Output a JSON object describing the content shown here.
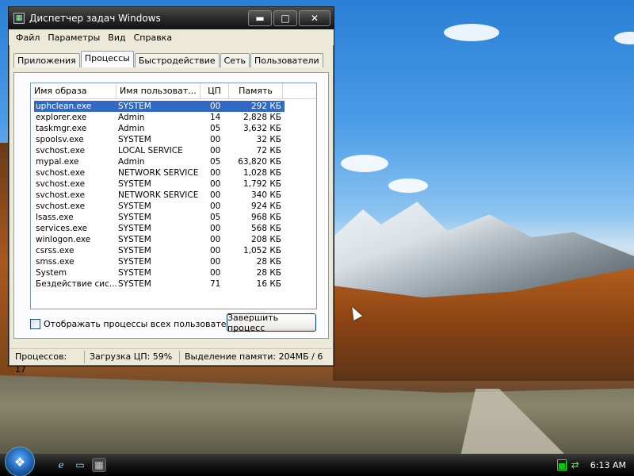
{
  "window": {
    "title": "Диспетчер задач Windows",
    "controls": {
      "minimize": "▬",
      "maximize": "□",
      "close": "✕"
    }
  },
  "menu": [
    "Файл",
    "Параметры",
    "Вид",
    "Справка"
  ],
  "tabs": [
    "Приложения",
    "Процессы",
    "Быстродействие",
    "Сеть",
    "Пользователи"
  ],
  "active_tab": "Процессы",
  "table": {
    "headers": [
      "Имя образа",
      "Имя пользоват...",
      "ЦП",
      "Память"
    ],
    "rows": [
      {
        "name": "uphclean.exe",
        "user": "SYSTEM",
        "cpu": "00",
        "mem": "292 КБ"
      },
      {
        "name": "explorer.exe",
        "user": "Admin",
        "cpu": "14",
        "mem": "2,828 КБ"
      },
      {
        "name": "taskmgr.exe",
        "user": "Admin",
        "cpu": "05",
        "mem": "3,632 КБ"
      },
      {
        "name": "spoolsv.exe",
        "user": "SYSTEM",
        "cpu": "00",
        "mem": "32 КБ"
      },
      {
        "name": "svchost.exe",
        "user": "LOCAL SERVICE",
        "cpu": "00",
        "mem": "72 КБ"
      },
      {
        "name": "mypal.exe",
        "user": "Admin",
        "cpu": "05",
        "mem": "63,820 КБ"
      },
      {
        "name": "svchost.exe",
        "user": "NETWORK SERVICE",
        "cpu": "00",
        "mem": "1,028 КБ"
      },
      {
        "name": "svchost.exe",
        "user": "SYSTEM",
        "cpu": "00",
        "mem": "1,792 КБ"
      },
      {
        "name": "svchost.exe",
        "user": "NETWORK SERVICE",
        "cpu": "00",
        "mem": "340 КБ"
      },
      {
        "name": "svchost.exe",
        "user": "SYSTEM",
        "cpu": "00",
        "mem": "924 КБ"
      },
      {
        "name": "lsass.exe",
        "user": "SYSTEM",
        "cpu": "05",
        "mem": "968 КБ"
      },
      {
        "name": "services.exe",
        "user": "SYSTEM",
        "cpu": "00",
        "mem": "568 КБ"
      },
      {
        "name": "winlogon.exe",
        "user": "SYSTEM",
        "cpu": "00",
        "mem": "208 КБ"
      },
      {
        "name": "csrss.exe",
        "user": "SYSTEM",
        "cpu": "00",
        "mem": "1,052 КБ"
      },
      {
        "name": "smss.exe",
        "user": "SYSTEM",
        "cpu": "00",
        "mem": "28 КБ"
      },
      {
        "name": "System",
        "user": "SYSTEM",
        "cpu": "00",
        "mem": "28 КБ"
      },
      {
        "name": "Бездействие сис...",
        "user": "SYSTEM",
        "cpu": "71",
        "mem": "16 КБ"
      }
    ],
    "selected_index": 0
  },
  "show_all_checkbox": {
    "label": "Отображать процессы всех пользователей",
    "checked": false
  },
  "end_process_button": "Завершить процесс",
  "status": {
    "processes": "Процессов: 17",
    "cpu": "Загрузка ЦП: 59%",
    "memory": "Выделение памяти: 204МБ / 6"
  },
  "taskbar": {
    "quick_launch": [
      "ie-icon",
      "show-desktop-icon",
      "task-manager-icon"
    ],
    "tray": [
      "cpu-meter-icon",
      "network-icon"
    ],
    "clock": "6:13 AM",
    "cpu_meter_level": 0.59
  },
  "colors": {
    "selection": "#316ac5",
    "window_face": "#ece9d8"
  }
}
